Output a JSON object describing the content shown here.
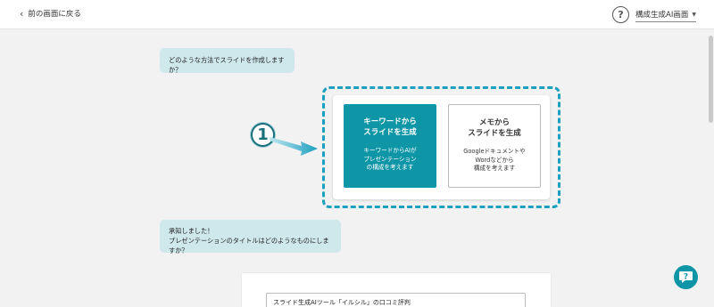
{
  "header": {
    "back_label": "前の画面に戻る",
    "help_icon_glyph": "?",
    "mode_label": "構成生成AI画面"
  },
  "chat": {
    "question_1": "どのような方法でスライドを作成しますか？",
    "reply_line_1": "承知しました！",
    "reply_line_2": "プレゼンテーションのタイトルはどのようなものにしますか？"
  },
  "options": {
    "keyword": {
      "title_line_1": "キーワードから",
      "title_line_2": "スライドを生成",
      "desc_line_1": "キーワードからAIが",
      "desc_line_2": "プレゼンテーション",
      "desc_line_3": "の構成を考えます"
    },
    "memo": {
      "title_line_1": "メモから",
      "title_line_2": "スライドを生成",
      "desc_line_1": "Googleドキュメントや",
      "desc_line_2": "Wordなどから",
      "desc_line_3": "構成を考えます"
    }
  },
  "annotation": {
    "number_glyph": "1"
  },
  "title_input": {
    "value": "スライド生成AIツール「イルシル」の口コミ評判"
  },
  "colors": {
    "accent": "#0e95a6",
    "bubble": "#cfe8ec",
    "dashed_frame": "#1d9fc0"
  }
}
